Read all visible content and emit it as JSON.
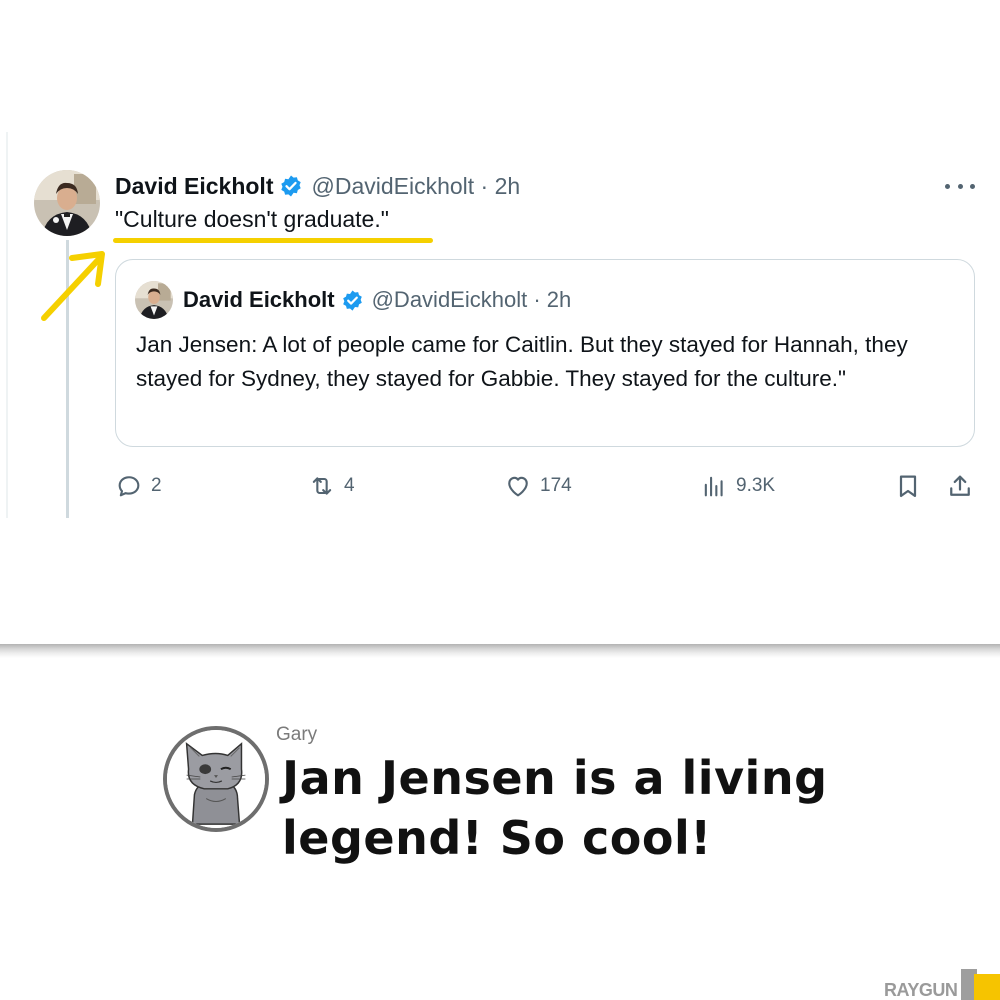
{
  "tweet": {
    "author_name": "David Eickholt",
    "handle_time": "@DavidEickholt · 2h",
    "text": "\"Culture doesn't graduate.\"",
    "quote": {
      "author_name": "David Eickholt",
      "handle_time": "@DavidEickholt · 2h",
      "text": "Jan Jensen: A lot of people came for Caitlin. But they stayed for Hannah, they stayed for Sydney, they stayed for Gabbie. They stayed for the culture.\""
    },
    "actions": {
      "replies": "2",
      "reposts": "4",
      "likes": "174",
      "views": "9.3K"
    },
    "icons": [
      "verified-badge-icon",
      "more-icon",
      "reply-icon",
      "repost-icon",
      "like-icon",
      "views-icon",
      "bookmark-icon",
      "share-icon"
    ],
    "highlight_color": "#f5d000",
    "verified_color": "#1d9bf0"
  },
  "comment": {
    "name": "Gary",
    "text": "Jan Jensen is a living legend! So cool!"
  },
  "watermark": {
    "text": "RAYGUN",
    "accent": "#f6c400"
  }
}
